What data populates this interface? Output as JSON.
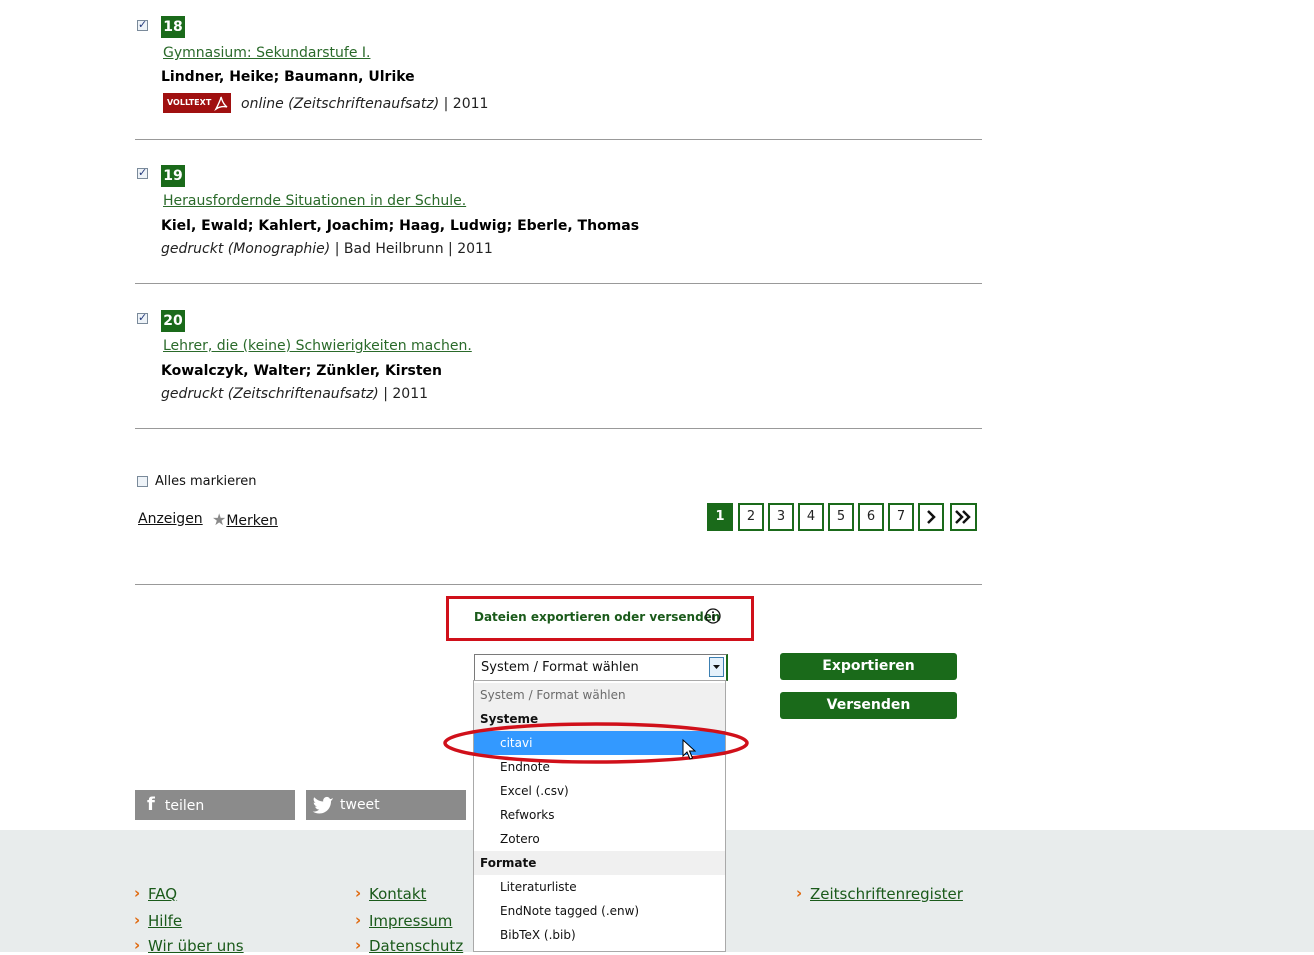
{
  "results": [
    {
      "number": "18",
      "title": "Gymnasium: Sekundarstufe I.",
      "authors": "Lindner, Heike; Baumann, Ulrike",
      "badge": "VOLLTEXT",
      "meta_type": "online (Zeitschriftenaufsatz)",
      "meta_rest": " | 2011",
      "checked": true
    },
    {
      "number": "19",
      "title": "Herausfordernde Situationen in der Schule.",
      "authors": "Kiel, Ewald; Kahlert, Joachim; Haag, Ludwig; Eberle, Thomas",
      "meta_type": "gedruckt (Monographie)",
      "meta_rest": " | Bad Heilbrunn | 2011",
      "checked": true
    },
    {
      "number": "20",
      "title": "Lehrer, die (keine) Schwierigkeiten machen.",
      "authors": "Kowalczyk, Walter; Zünkler, Kirsten",
      "meta_type": "gedruckt (Zeitschriftenaufsatz)",
      "meta_rest": " | 2011",
      "checked": true
    }
  ],
  "select_all": {
    "label": "Alles markieren",
    "checked": false
  },
  "actions": {
    "show": "Anzeigen",
    "remember": "Merken"
  },
  "pagination": {
    "pages": [
      "1",
      "2",
      "3",
      "4",
      "5",
      "6",
      "7"
    ],
    "active": "1",
    "next": "›",
    "last": "»"
  },
  "export": {
    "heading": "Dateien exportieren oder versenden",
    "select_value": "System / Format wählen",
    "export_button": "Exportieren",
    "send_button": "Versenden",
    "dropdown": {
      "placeholder": "System / Format wählen",
      "group_systems": "Systeme",
      "systems": [
        "citavi",
        "Endnote",
        "Excel (.csv)",
        "Refworks",
        "Zotero"
      ],
      "group_formats": "Formate",
      "formats": [
        "Literaturliste",
        "EndNote tagged (.enw)",
        "BibTeX (.bib)"
      ],
      "selected": "citavi"
    }
  },
  "share": {
    "facebook": "teilen",
    "twitter": "tweet"
  },
  "footer": {
    "col1": [
      "FAQ",
      "Hilfe",
      "Wir über uns"
    ],
    "col2": [
      "Kontakt",
      "Impressum",
      "Datenschutz"
    ],
    "col4": [
      "Zeitschriftenregister"
    ]
  },
  "colors": {
    "brand_green": "#1a6a1a",
    "highlight_red": "#d0101a",
    "selected_blue": "#3399ff",
    "chevron_orange": "#e06a10"
  }
}
